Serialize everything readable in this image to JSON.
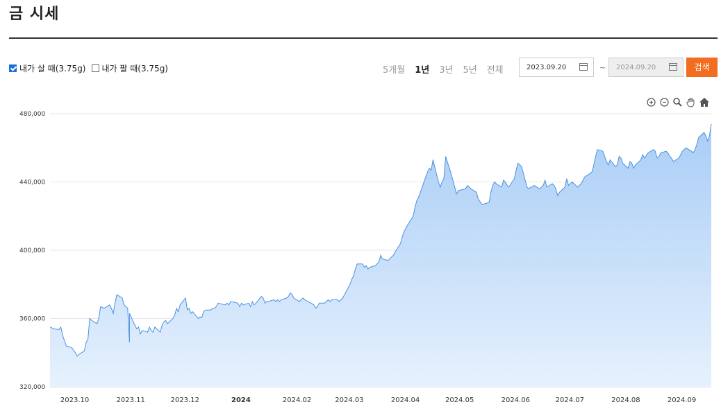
{
  "page": {
    "title": "금 시세"
  },
  "filters": {
    "buy_label": "내가 살 때(3.75g)",
    "sell_label": "내가 팔 때(3.75g)",
    "buy_checked": true,
    "sell_checked": false
  },
  "periods": [
    "5개월",
    "1년",
    "3년",
    "5년",
    "전체"
  ],
  "active_period": "1년",
  "dates": {
    "from": "2023.09.20",
    "to": "2024.09.20",
    "tilde": "~"
  },
  "search_label": "검색",
  "toolbar_icons": [
    "zoom-in-icon",
    "zoom-out-icon",
    "magnify-icon",
    "pan-hand-icon",
    "home-icon"
  ],
  "colors": {
    "line": "#4a90e2",
    "fill_top": "#a9cdf6",
    "fill_bottom": "#e6f1fd",
    "accent": "#f26d1f"
  },
  "chart_data": {
    "type": "area",
    "title": "",
    "xlabel": "",
    "ylabel": "",
    "ylim": [
      320000,
      480000
    ],
    "yticks": [
      320000,
      360000,
      400000,
      440000,
      480000
    ],
    "ytick_labels": [
      "320,000",
      "360,000",
      "400,000",
      "440,000",
      "480,000"
    ],
    "xtick_labels": [
      "2023.10",
      "2023.11",
      "2023.12",
      "2024",
      "2024.02",
      "2024.03",
      "2024.04",
      "2024.05",
      "2024.06",
      "2024.07",
      "2024.08",
      "2024.09"
    ],
    "xticks": [
      "2023-10-01",
      "2023-11-01",
      "2023-12-01",
      "2024-01-01",
      "2024-02-01",
      "2024-03-01",
      "2024-04-01",
      "2024-05-01",
      "2024-06-01",
      "2024-07-01",
      "2024-08-01",
      "2024-09-01"
    ],
    "bold_tick": "2024",
    "x_range": [
      "2023-09-20",
      "2024-09-20"
    ],
    "grid": true,
    "series": [
      {
        "points": [
          [
            "2023-09-20",
            355000
          ],
          [
            "2023-09-22",
            354000
          ],
          [
            "2023-09-25",
            353500
          ],
          [
            "2023-09-26",
            355000
          ],
          [
            "2023-09-27",
            350000
          ],
          [
            "2023-09-29",
            344000
          ],
          [
            "2023-10-02",
            343000
          ],
          [
            "2023-10-04",
            340000
          ],
          [
            "2023-10-05",
            338000
          ],
          [
            "2023-10-06",
            339000
          ],
          [
            "2023-10-09",
            341000
          ],
          [
            "2023-10-10",
            346000
          ],
          [
            "2023-10-11",
            348000
          ],
          [
            "2023-10-12",
            360000
          ],
          [
            "2023-10-13",
            359000
          ],
          [
            "2023-10-16",
            357000
          ],
          [
            "2023-10-17",
            360000
          ],
          [
            "2023-10-18",
            367000
          ],
          [
            "2023-10-20",
            366000
          ],
          [
            "2023-10-23",
            368000
          ],
          [
            "2023-10-24",
            366000
          ],
          [
            "2023-10-25",
            363000
          ],
          [
            "2023-10-26",
            369000
          ],
          [
            "2023-10-27",
            374000
          ],
          [
            "2023-10-30",
            372000
          ],
          [
            "2023-10-31",
            368000
          ],
          [
            "2023-11-02",
            366000
          ],
          [
            "2023-11-03",
            346000
          ],
          [
            "2023-11-03",
            363000
          ],
          [
            "2023-11-06",
            356000
          ],
          [
            "2023-11-07",
            354000
          ],
          [
            "2023-11-08",
            355000
          ],
          [
            "2023-11-09",
            351000
          ],
          [
            "2023-11-10",
            353000
          ],
          [
            "2023-11-13",
            352000
          ],
          [
            "2023-11-14",
            355000
          ],
          [
            "2023-11-15",
            353000
          ],
          [
            "2023-11-16",
            352000
          ],
          [
            "2023-11-17",
            355000
          ],
          [
            "2023-11-20",
            352000
          ],
          [
            "2023-11-21",
            356000
          ],
          [
            "2023-11-22",
            358000
          ],
          [
            "2023-11-23",
            359000
          ],
          [
            "2023-11-24",
            357000
          ],
          [
            "2023-11-27",
            360000
          ],
          [
            "2023-11-28",
            362000
          ],
          [
            "2023-11-29",
            366000
          ],
          [
            "2023-11-30",
            364000
          ],
          [
            "2023-12-01",
            368000
          ],
          [
            "2023-12-04",
            372000
          ],
          [
            "2023-12-05",
            365000
          ],
          [
            "2023-12-06",
            366000
          ],
          [
            "2023-12-07",
            363000
          ],
          [
            "2023-12-08",
            364000
          ],
          [
            "2023-12-11",
            360000
          ],
          [
            "2023-12-12",
            361000
          ],
          [
            "2023-12-13",
            360500
          ],
          [
            "2023-12-14",
            364000
          ],
          [
            "2023-12-15",
            365000
          ],
          [
            "2023-12-18",
            365000
          ],
          [
            "2023-12-19",
            366000
          ],
          [
            "2023-12-20",
            366000
          ],
          [
            "2023-12-21",
            367000
          ],
          [
            "2023-12-22",
            369000
          ],
          [
            "2023-12-26",
            368000
          ],
          [
            "2023-12-27",
            369000
          ],
          [
            "2023-12-28",
            368000
          ],
          [
            "2023-12-29",
            370000
          ],
          [
            "2024-01-02",
            369000
          ],
          [
            "2024-01-03",
            367000
          ],
          [
            "2024-01-04",
            369000
          ],
          [
            "2024-01-05",
            368000
          ],
          [
            "2024-01-08",
            369000
          ],
          [
            "2024-01-09",
            367000
          ],
          [
            "2024-01-10",
            370000
          ],
          [
            "2024-01-11",
            368000
          ],
          [
            "2024-01-12",
            369000
          ],
          [
            "2024-01-15",
            373000
          ],
          [
            "2024-01-16",
            372000
          ],
          [
            "2024-01-17",
            369000
          ],
          [
            "2024-01-18",
            370000
          ],
          [
            "2024-01-19",
            370000
          ],
          [
            "2024-01-22",
            371000
          ],
          [
            "2024-01-23",
            370000
          ],
          [
            "2024-01-24",
            371000
          ],
          [
            "2024-01-25",
            370000
          ],
          [
            "2024-01-26",
            371000
          ],
          [
            "2024-01-29",
            372000
          ],
          [
            "2024-01-30",
            373000
          ],
          [
            "2024-01-31",
            375000
          ],
          [
            "2024-02-01",
            374000
          ],
          [
            "2024-02-02",
            372000
          ],
          [
            "2024-02-05",
            370000
          ],
          [
            "2024-02-06",
            371000
          ],
          [
            "2024-02-07",
            372000
          ],
          [
            "2024-02-08",
            371000
          ],
          [
            "2024-02-13",
            368000
          ],
          [
            "2024-02-14",
            366000
          ],
          [
            "2024-02-15",
            367000
          ],
          [
            "2024-02-16",
            369000
          ],
          [
            "2024-02-19",
            369000
          ],
          [
            "2024-02-20",
            370000
          ],
          [
            "2024-02-21",
            371000
          ],
          [
            "2024-02-22",
            370000
          ],
          [
            "2024-02-23",
            371000
          ],
          [
            "2024-02-26",
            371000
          ],
          [
            "2024-02-27",
            370000
          ],
          [
            "2024-02-28",
            371000
          ],
          [
            "2024-02-29",
            372000
          ],
          [
            "2024-03-01",
            374000
          ],
          [
            "2024-03-04",
            380000
          ],
          [
            "2024-03-05",
            383000
          ],
          [
            "2024-03-06",
            385000
          ],
          [
            "2024-03-07",
            389000
          ],
          [
            "2024-03-08",
            392000
          ],
          [
            "2024-03-11",
            392000
          ],
          [
            "2024-03-12",
            390000
          ],
          [
            "2024-03-13",
            391000
          ],
          [
            "2024-03-14",
            389000
          ],
          [
            "2024-03-15",
            390000
          ],
          [
            "2024-03-18",
            391000
          ],
          [
            "2024-03-19",
            392000
          ],
          [
            "2024-03-20",
            393000
          ],
          [
            "2024-03-21",
            397000
          ],
          [
            "2024-03-22",
            395000
          ],
          [
            "2024-03-25",
            394000
          ],
          [
            "2024-03-26",
            395000
          ],
          [
            "2024-03-27",
            396000
          ],
          [
            "2024-03-28",
            397000
          ],
          [
            "2024-03-29",
            399000
          ],
          [
            "2024-04-01",
            404000
          ],
          [
            "2024-04-02",
            408000
          ],
          [
            "2024-04-03",
            411000
          ],
          [
            "2024-04-04",
            413000
          ],
          [
            "2024-04-05",
            415000
          ],
          [
            "2024-04-08",
            420000
          ],
          [
            "2024-04-09",
            425000
          ],
          [
            "2024-04-10",
            429000
          ],
          [
            "2024-04-11",
            431000
          ],
          [
            "2024-04-12",
            434000
          ],
          [
            "2024-04-15",
            443000
          ],
          [
            "2024-04-16",
            446000
          ],
          [
            "2024-04-17",
            448000
          ],
          [
            "2024-04-18",
            447000
          ],
          [
            "2024-04-19",
            453000
          ],
          [
            "2024-04-22",
            440000
          ],
          [
            "2024-04-23",
            437000
          ],
          [
            "2024-04-24",
            440000
          ],
          [
            "2024-04-25",
            442000
          ],
          [
            "2024-04-26",
            455000
          ],
          [
            "2024-04-29",
            445000
          ],
          [
            "2024-04-30",
            441000
          ],
          [
            "2024-05-02",
            433000
          ],
          [
            "2024-05-03",
            435000
          ],
          [
            "2024-05-07",
            436000
          ],
          [
            "2024-05-08",
            438000
          ],
          [
            "2024-05-09",
            437000
          ],
          [
            "2024-05-10",
            436000
          ],
          [
            "2024-05-13",
            434000
          ],
          [
            "2024-05-14",
            430000
          ],
          [
            "2024-05-16",
            427000
          ],
          [
            "2024-05-17",
            427000
          ],
          [
            "2024-05-20",
            428000
          ],
          [
            "2024-05-21",
            434000
          ],
          [
            "2024-05-22",
            438000
          ],
          [
            "2024-05-23",
            440000
          ],
          [
            "2024-05-24",
            439000
          ],
          [
            "2024-05-27",
            437000
          ],
          [
            "2024-05-28",
            441000
          ],
          [
            "2024-05-29",
            440000
          ],
          [
            "2024-05-30",
            438000
          ],
          [
            "2024-05-31",
            437000
          ],
          [
            "2024-06-03",
            442000
          ],
          [
            "2024-06-04",
            447000
          ],
          [
            "2024-06-05",
            451000
          ],
          [
            "2024-06-07",
            449000
          ],
          [
            "2024-06-10",
            437000
          ],
          [
            "2024-06-11",
            436000
          ],
          [
            "2024-06-12",
            437000
          ],
          [
            "2024-06-13",
            437000
          ],
          [
            "2024-06-14",
            438000
          ],
          [
            "2024-06-17",
            436000
          ],
          [
            "2024-06-18",
            437000
          ],
          [
            "2024-06-19",
            438000
          ],
          [
            "2024-06-20",
            441000
          ],
          [
            "2024-06-21",
            437000
          ],
          [
            "2024-06-24",
            439000
          ],
          [
            "2024-06-25",
            438000
          ],
          [
            "2024-06-26",
            436000
          ],
          [
            "2024-06-27",
            432000
          ],
          [
            "2024-06-28",
            434000
          ],
          [
            "2024-07-01",
            437000
          ],
          [
            "2024-07-02",
            442000
          ],
          [
            "2024-07-03",
            438000
          ],
          [
            "2024-07-04",
            439000
          ],
          [
            "2024-07-05",
            440000
          ],
          [
            "2024-07-08",
            437000
          ],
          [
            "2024-07-09",
            438000
          ],
          [
            "2024-07-10",
            439000
          ],
          [
            "2024-07-11",
            441000
          ],
          [
            "2024-07-12",
            443000
          ],
          [
            "2024-07-15",
            445000
          ],
          [
            "2024-07-16",
            446000
          ],
          [
            "2024-07-17",
            450000
          ],
          [
            "2024-07-18",
            455000
          ],
          [
            "2024-07-19",
            459000
          ],
          [
            "2024-07-22",
            458000
          ],
          [
            "2024-07-23",
            455000
          ],
          [
            "2024-07-24",
            452000
          ],
          [
            "2024-07-25",
            450000
          ],
          [
            "2024-07-26",
            453000
          ],
          [
            "2024-07-29",
            449000
          ],
          [
            "2024-07-30",
            450000
          ],
          [
            "2024-07-31",
            455000
          ],
          [
            "2024-08-01",
            454000
          ],
          [
            "2024-08-02",
            451000
          ],
          [
            "2024-08-05",
            448000
          ],
          [
            "2024-08-06",
            452000
          ],
          [
            "2024-08-07",
            451000
          ],
          [
            "2024-08-08",
            448000
          ],
          [
            "2024-08-09",
            450000
          ],
          [
            "2024-08-12",
            453000
          ],
          [
            "2024-08-13",
            456000
          ],
          [
            "2024-08-14",
            454000
          ],
          [
            "2024-08-16",
            457000
          ],
          [
            "2024-08-19",
            459000
          ],
          [
            "2024-08-20",
            458000
          ],
          [
            "2024-08-21",
            454000
          ],
          [
            "2024-08-22",
            455000
          ],
          [
            "2024-08-23",
            457000
          ],
          [
            "2024-08-26",
            458000
          ],
          [
            "2024-08-27",
            457000
          ],
          [
            "2024-08-28",
            455000
          ],
          [
            "2024-08-29",
            454000
          ],
          [
            "2024-08-30",
            452000
          ],
          [
            "2024-09-02",
            454000
          ],
          [
            "2024-09-03",
            456000
          ],
          [
            "2024-09-04",
            458000
          ],
          [
            "2024-09-05",
            459000
          ],
          [
            "2024-09-06",
            460000
          ],
          [
            "2024-09-09",
            458000
          ],
          [
            "2024-09-10",
            457000
          ],
          [
            "2024-09-11",
            459000
          ],
          [
            "2024-09-12",
            462000
          ],
          [
            "2024-09-13",
            466000
          ],
          [
            "2024-09-16",
            469000
          ],
          [
            "2024-09-17",
            467000
          ],
          [
            "2024-09-18",
            464000
          ],
          [
            "2024-09-19",
            467000
          ],
          [
            "2024-09-20",
            474000
          ]
        ]
      }
    ]
  }
}
